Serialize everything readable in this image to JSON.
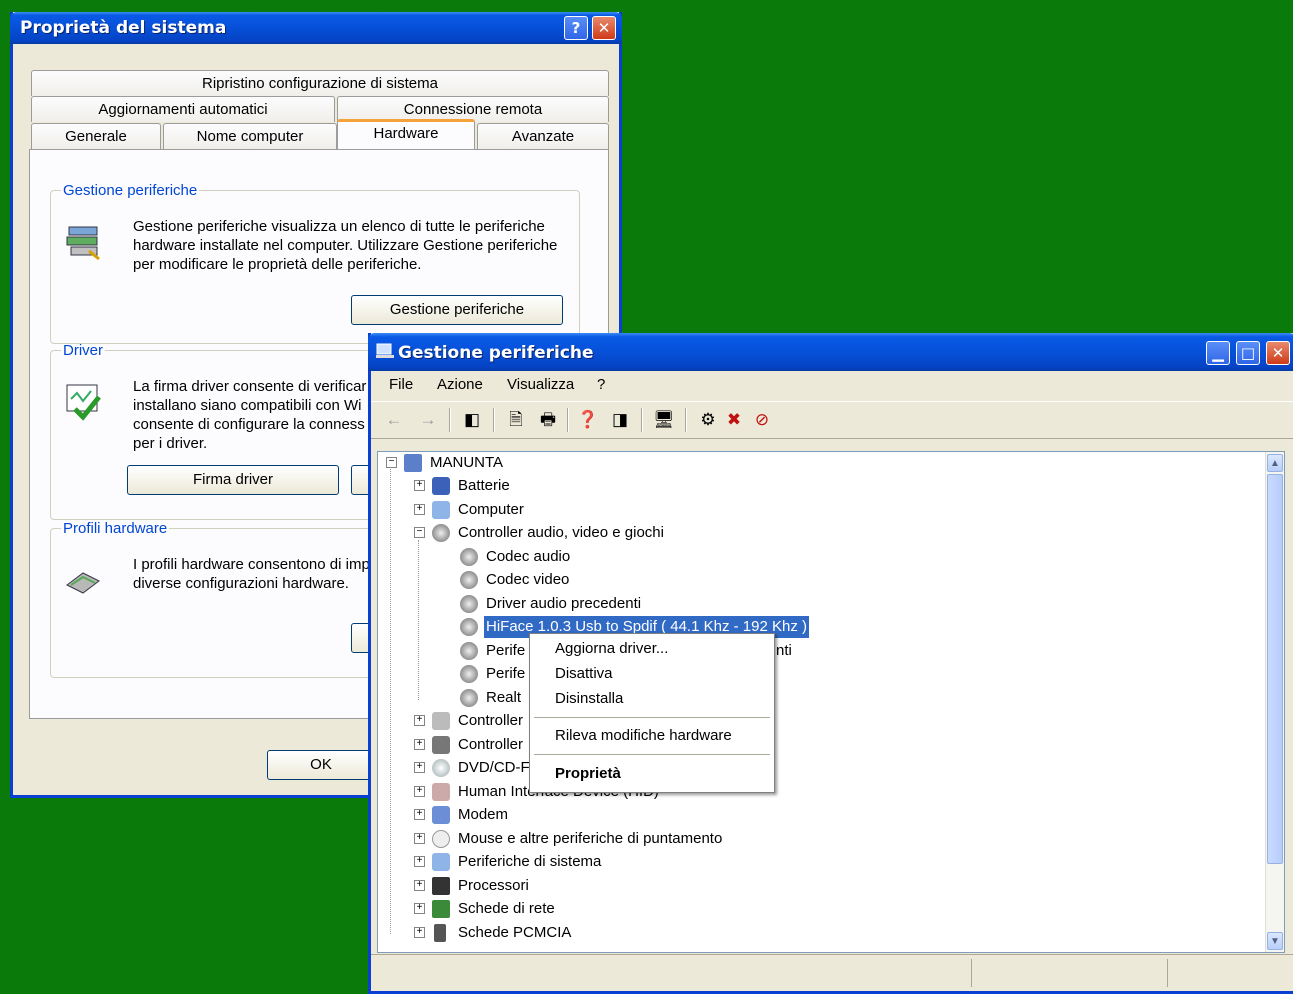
{
  "sysprops": {
    "title": "Proprietà del sistema",
    "help_btn": "?",
    "close_btn": "✕",
    "tabs": {
      "ripristino": "Ripristino configurazione di sistema",
      "aggiornamenti": "Aggiornamenti automatici",
      "connessione": "Connessione remota",
      "generale": "Generale",
      "nome": "Nome computer",
      "hardware": "Hardware",
      "avanzate": "Avanzate"
    },
    "gestione": {
      "legend": "Gestione periferiche",
      "text": "Gestione periferiche visualizza un elenco di tutte le periferiche hardware installate nel computer. Utilizzare Gestione periferiche per modificare le proprietà delle periferiche.",
      "button": "Gestione periferiche"
    },
    "driver": {
      "legend": "Driver",
      "text": "La firma driver consente di verificar installano siano compatibili con Wi consente di configurare la conness per i driver.",
      "button": "Firma driver"
    },
    "profili": {
      "legend": "Profili hardware",
      "text": "I profili hardware consentono di imp diverse configurazioni hardware."
    },
    "ok": "OK"
  },
  "devmgr": {
    "title": "Gestione periferiche",
    "menu": {
      "file": "File",
      "azione": "Azione",
      "visualizza": "Visualizza",
      "help": "?"
    },
    "tree": {
      "root": "MANUNTA",
      "items": [
        "Batterie",
        "Computer",
        "Controller audio, video e giochi",
        "Codec audio",
        "Codec video",
        "Driver audio precedenti",
        "HiFace 1.0.3 Usb to Spdif ( 44.1 Khz - 192 Khz )",
        "Perife",
        "Perife",
        "Realt",
        "Controller",
        "Controller",
        "DVD/CD-F",
        "Human Interface Device (HID)",
        "Modem",
        "Mouse e altre periferiche di puntamento",
        "Periferiche di sistema",
        "Processori",
        "Schede di rete",
        "Schede PCMCIA"
      ],
      "partial_suffix": "nti"
    }
  },
  "context_menu": {
    "aggiorna": "Aggiorna driver...",
    "disattiva": "Disattiva",
    "disinstalla": "Disinstalla",
    "rileva": "Rileva modifiche hardware",
    "proprieta": "Proprietà"
  },
  "colors": {
    "desktop": "#0a7a0a",
    "title_blue": "#0650d8",
    "selection": "#316ac5",
    "group_label": "#0046d5"
  }
}
